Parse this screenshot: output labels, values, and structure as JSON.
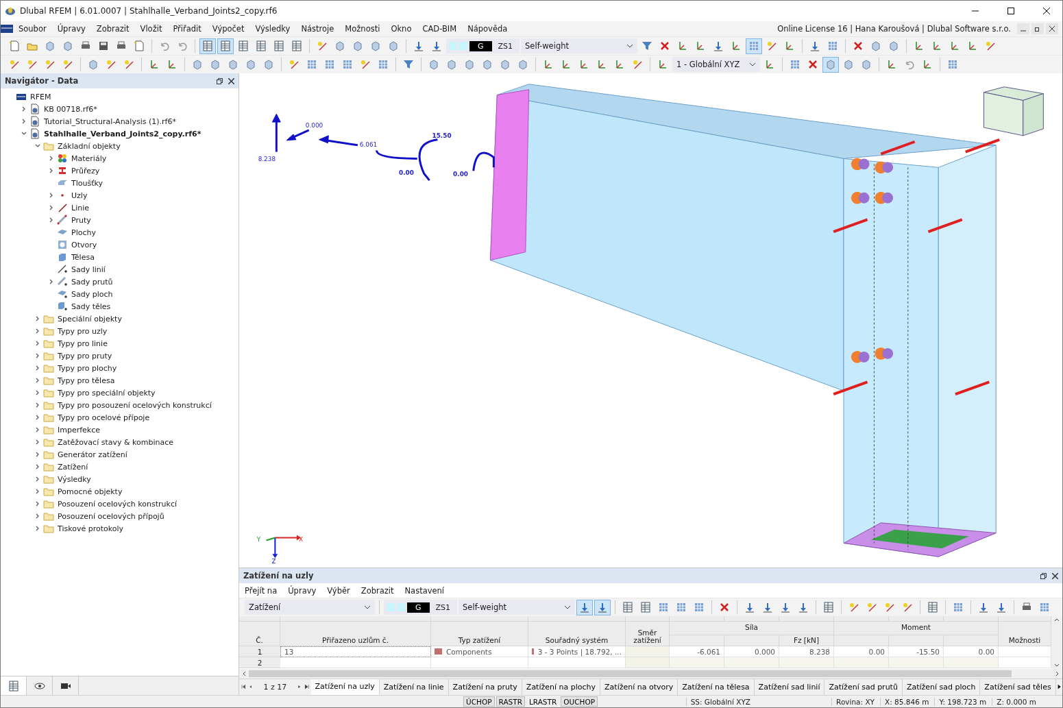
{
  "window": {
    "title": "Dlubal RFEM | 6.01.0007 | Stahlhalle_Verband_Joints2_copy.rf6"
  },
  "menu": {
    "items": [
      "Soubor",
      "Úpravy",
      "Zobrazit",
      "Vložit",
      "Přiřadit",
      "Výpočet",
      "Výsledky",
      "Nástroje",
      "Možnosti",
      "Okno",
      "CAD-BIM",
      "Nápověda"
    ],
    "license": "Online License 16 | Hana Karoušová | Dlubal Software s.r.o."
  },
  "toolbar": {
    "load_case": {
      "type": "G",
      "id": "ZS1",
      "name": "Self-weight"
    },
    "coordinate_system": "1 - Globální XYZ"
  },
  "navigator": {
    "title": "Navigátor - Data",
    "tree": [
      {
        "label": "RFEM",
        "kind": "rfem",
        "children": [
          {
            "label": "KB 00718.rf6*",
            "kind": "file",
            "expanded": false,
            "current": false
          },
          {
            "label": "Tutorial_Structural-Analysis (1).rf6*",
            "kind": "file",
            "expanded": false,
            "current": false
          },
          {
            "label": "Stahlhalle_Verband_Joints2_copy.rf6*",
            "kind": "file",
            "expanded": true,
            "current": true,
            "children": [
              {
                "label": "Základní objekty",
                "kind": "folder",
                "expanded": true,
                "children": [
                  {
                    "label": "Materiály",
                    "kind": "materials",
                    "expanded": false
                  },
                  {
                    "label": "Průřezy",
                    "kind": "sections",
                    "expanded": false
                  },
                  {
                    "label": "Tloušťky",
                    "kind": "thickness"
                  },
                  {
                    "label": "Uzly",
                    "kind": "node",
                    "expanded": false
                  },
                  {
                    "label": "Linie",
                    "kind": "line",
                    "expanded": false
                  },
                  {
                    "label": "Pruty",
                    "kind": "member",
                    "expanded": false
                  },
                  {
                    "label": "Plochy",
                    "kind": "surface"
                  },
                  {
                    "label": "Otvory",
                    "kind": "opening"
                  },
                  {
                    "label": "Tělesa",
                    "kind": "solid"
                  },
                  {
                    "label": "Sady linií",
                    "kind": "lineset"
                  },
                  {
                    "label": "Sady prutů",
                    "kind": "memberset",
                    "expanded": false
                  },
                  {
                    "label": "Sady ploch",
                    "kind": "surfaceset"
                  },
                  {
                    "label": "Sady těles",
                    "kind": "solidset"
                  }
                ]
              },
              {
                "label": "Speciální objekty",
                "kind": "folder",
                "expanded": false
              },
              {
                "label": "Typy pro uzly",
                "kind": "folder",
                "expanded": false
              },
              {
                "label": "Typy pro linie",
                "kind": "folder",
                "expanded": false
              },
              {
                "label": "Typy pro pruty",
                "kind": "folder",
                "expanded": false
              },
              {
                "label": "Typy pro plochy",
                "kind": "folder",
                "expanded": false
              },
              {
                "label": "Typy pro tělesa",
                "kind": "folder",
                "expanded": false
              },
              {
                "label": "Typy pro speciální objekty",
                "kind": "folder",
                "expanded": false
              },
              {
                "label": "Typy pro posouzení ocelových konstrukcí",
                "kind": "folder",
                "expanded": false
              },
              {
                "label": "Typy pro ocelové přípoje",
                "kind": "folder",
                "expanded": false
              },
              {
                "label": "Imperfekce",
                "kind": "folder",
                "expanded": false
              },
              {
                "label": "Zatěžovací stavy & kombinace",
                "kind": "folder",
                "expanded": false
              },
              {
                "label": "Generátor zatížení",
                "kind": "folder",
                "expanded": false
              },
              {
                "label": "Zatížení",
                "kind": "folder",
                "expanded": false
              },
              {
                "label": "Výsledky",
                "kind": "folder",
                "expanded": false
              },
              {
                "label": "Pomocné objekty",
                "kind": "folder",
                "expanded": false
              },
              {
                "label": "Posouzení ocelových konstrukcí",
                "kind": "folder",
                "expanded": false
              },
              {
                "label": "Posouzení ocelových přípojů",
                "kind": "folder",
                "expanded": false
              },
              {
                "label": "Tiskové protokoly",
                "kind": "folder",
                "expanded": false
              }
            ]
          }
        ]
      }
    ]
  },
  "viewport": {
    "load_labels": [
      {
        "text": "8.238",
        "kind": "force"
      },
      {
        "text": "0.000",
        "kind": "force"
      },
      {
        "text": "6.061",
        "kind": "force"
      },
      {
        "text": "15.50",
        "kind": "moment"
      },
      {
        "text": "0.00",
        "kind": "moment"
      },
      {
        "text": "0.00",
        "kind": "moment"
      }
    ],
    "axes": [
      "Y",
      "X",
      "Z"
    ]
  },
  "table_panel": {
    "title": "Zatížení na uzly",
    "menu": [
      "Přejít na",
      "Úpravy",
      "Výběr",
      "Zobrazit",
      "Nastavení"
    ],
    "category": "Zatížení",
    "load_case": {
      "type": "G",
      "id": "ZS1",
      "name": "Self-weight"
    },
    "columns": [
      "Č.",
      "Přiřazeno uzlům č.",
      "Typ zatížení",
      "Souřadný systém",
      "Směr zatížení"
    ],
    "groups": [
      {
        "label": "Síla",
        "sub": [
          "Fz [kN]"
        ]
      },
      {
        "label": "Moment"
      }
    ],
    "options_column": "Možnosti",
    "rows": [
      {
        "no": "1",
        "nodes": "13",
        "load_type": {
          "text": "Components",
          "color": "#c07070"
        },
        "coordinate_system": {
          "text": "3 - 3 Points | 18.792, ...",
          "color": "#c07070"
        },
        "values": [
          "-6.061",
          "0.000",
          "8.238",
          "0.00",
          "-15.50",
          "0.00"
        ]
      },
      {
        "no": "2"
      }
    ],
    "pager": "1 z 17",
    "tabs": [
      {
        "label": "Zatížení na uzly",
        "selected": true
      },
      {
        "label": "Zatížení na linie",
        "selected": false
      },
      {
        "label": "Zatížení na pruty",
        "selected": false
      },
      {
        "label": "Zatížení na plochy",
        "selected": false
      },
      {
        "label": "Zatížení na otvory",
        "selected": false
      },
      {
        "label": "Zatížení na tělesa",
        "selected": false
      },
      {
        "label": "Zatížení sad linií",
        "selected": false
      },
      {
        "label": "Zatížení sad prutů",
        "selected": false
      },
      {
        "label": "Zatížení sad ploch",
        "selected": false
      },
      {
        "label": "Zatížení sad těles",
        "selected": false
      }
    ]
  },
  "status_bar": {
    "toggles": [
      {
        "label": "ÚCHOP",
        "on": true
      },
      {
        "label": "RASTR",
        "on": true
      },
      {
        "label": "LRASTR",
        "on": false
      },
      {
        "label": "OUCHOP",
        "on": true
      }
    ],
    "fields": [
      "SS: Globální XYZ",
      "Rovina: XY",
      "X: 85.846 m",
      "Y: 198.723 m",
      "Z: 0.000 m"
    ]
  }
}
